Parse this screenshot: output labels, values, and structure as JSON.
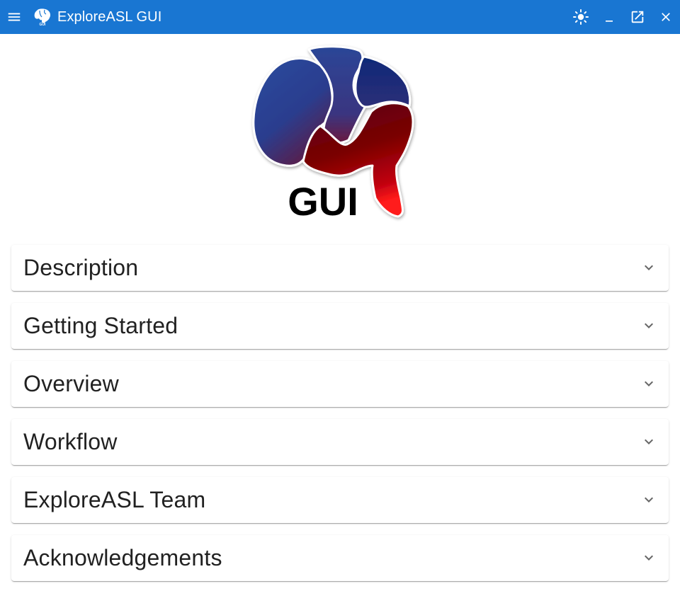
{
  "window": {
    "title": "ExploreASL GUI",
    "controls": {
      "menu": "menu-icon",
      "app_icon": "brain-icon",
      "theme": "brightness-icon",
      "minimize": "minimize-icon",
      "popout": "open-in-new-icon",
      "close": "close-icon"
    }
  },
  "logo": {
    "text": "GUI"
  },
  "panels": [
    {
      "label": "Description"
    },
    {
      "label": "Getting Started"
    },
    {
      "label": "Overview"
    },
    {
      "label": "Workflow"
    },
    {
      "label": "ExploreASL Team"
    },
    {
      "label": "Acknowledgements"
    }
  ],
  "colors": {
    "titlebar": "#1976d2",
    "brain_blue": "#2a3f8f",
    "brain_red": "#8b0000"
  }
}
